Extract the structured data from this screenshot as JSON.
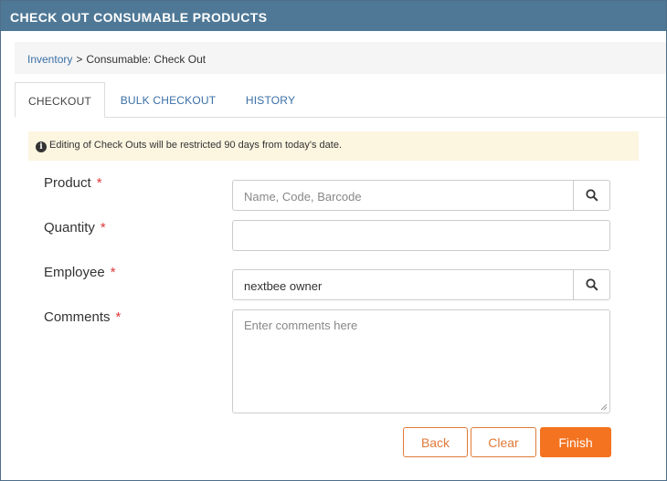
{
  "window": {
    "title": "CHECK OUT CONSUMABLE PRODUCTS"
  },
  "breadcrumb": {
    "link": "Inventory",
    "separator": ">",
    "current": "Consumable: Check Out"
  },
  "tabs": [
    {
      "label": "CHECKOUT",
      "active": true
    },
    {
      "label": "BULK CHECKOUT",
      "active": false
    },
    {
      "label": "HISTORY",
      "active": false
    }
  ],
  "notice": {
    "icon": "info-icon",
    "text": "Editing of Check Outs will be restricted 90 days from today's date."
  },
  "form": {
    "required_marker": "*",
    "product": {
      "label": "Product",
      "placeholder": "Name, Code, Barcode",
      "value": "",
      "button_icon": "search-icon"
    },
    "quantity": {
      "label": "Quantity",
      "value": ""
    },
    "employee": {
      "label": "Employee",
      "value": "nextbee owner",
      "button_icon": "search-icon"
    },
    "comments": {
      "label": "Comments",
      "placeholder": "Enter comments here",
      "value": ""
    }
  },
  "actions": {
    "back": "Back",
    "clear": "Clear",
    "finish": "Finish"
  },
  "colors": {
    "title_bar": "#4f7896",
    "link": "#3a6fa6",
    "accent": "#f47320",
    "required": "#e0393a",
    "notice_bg": "#fcf5e0"
  }
}
